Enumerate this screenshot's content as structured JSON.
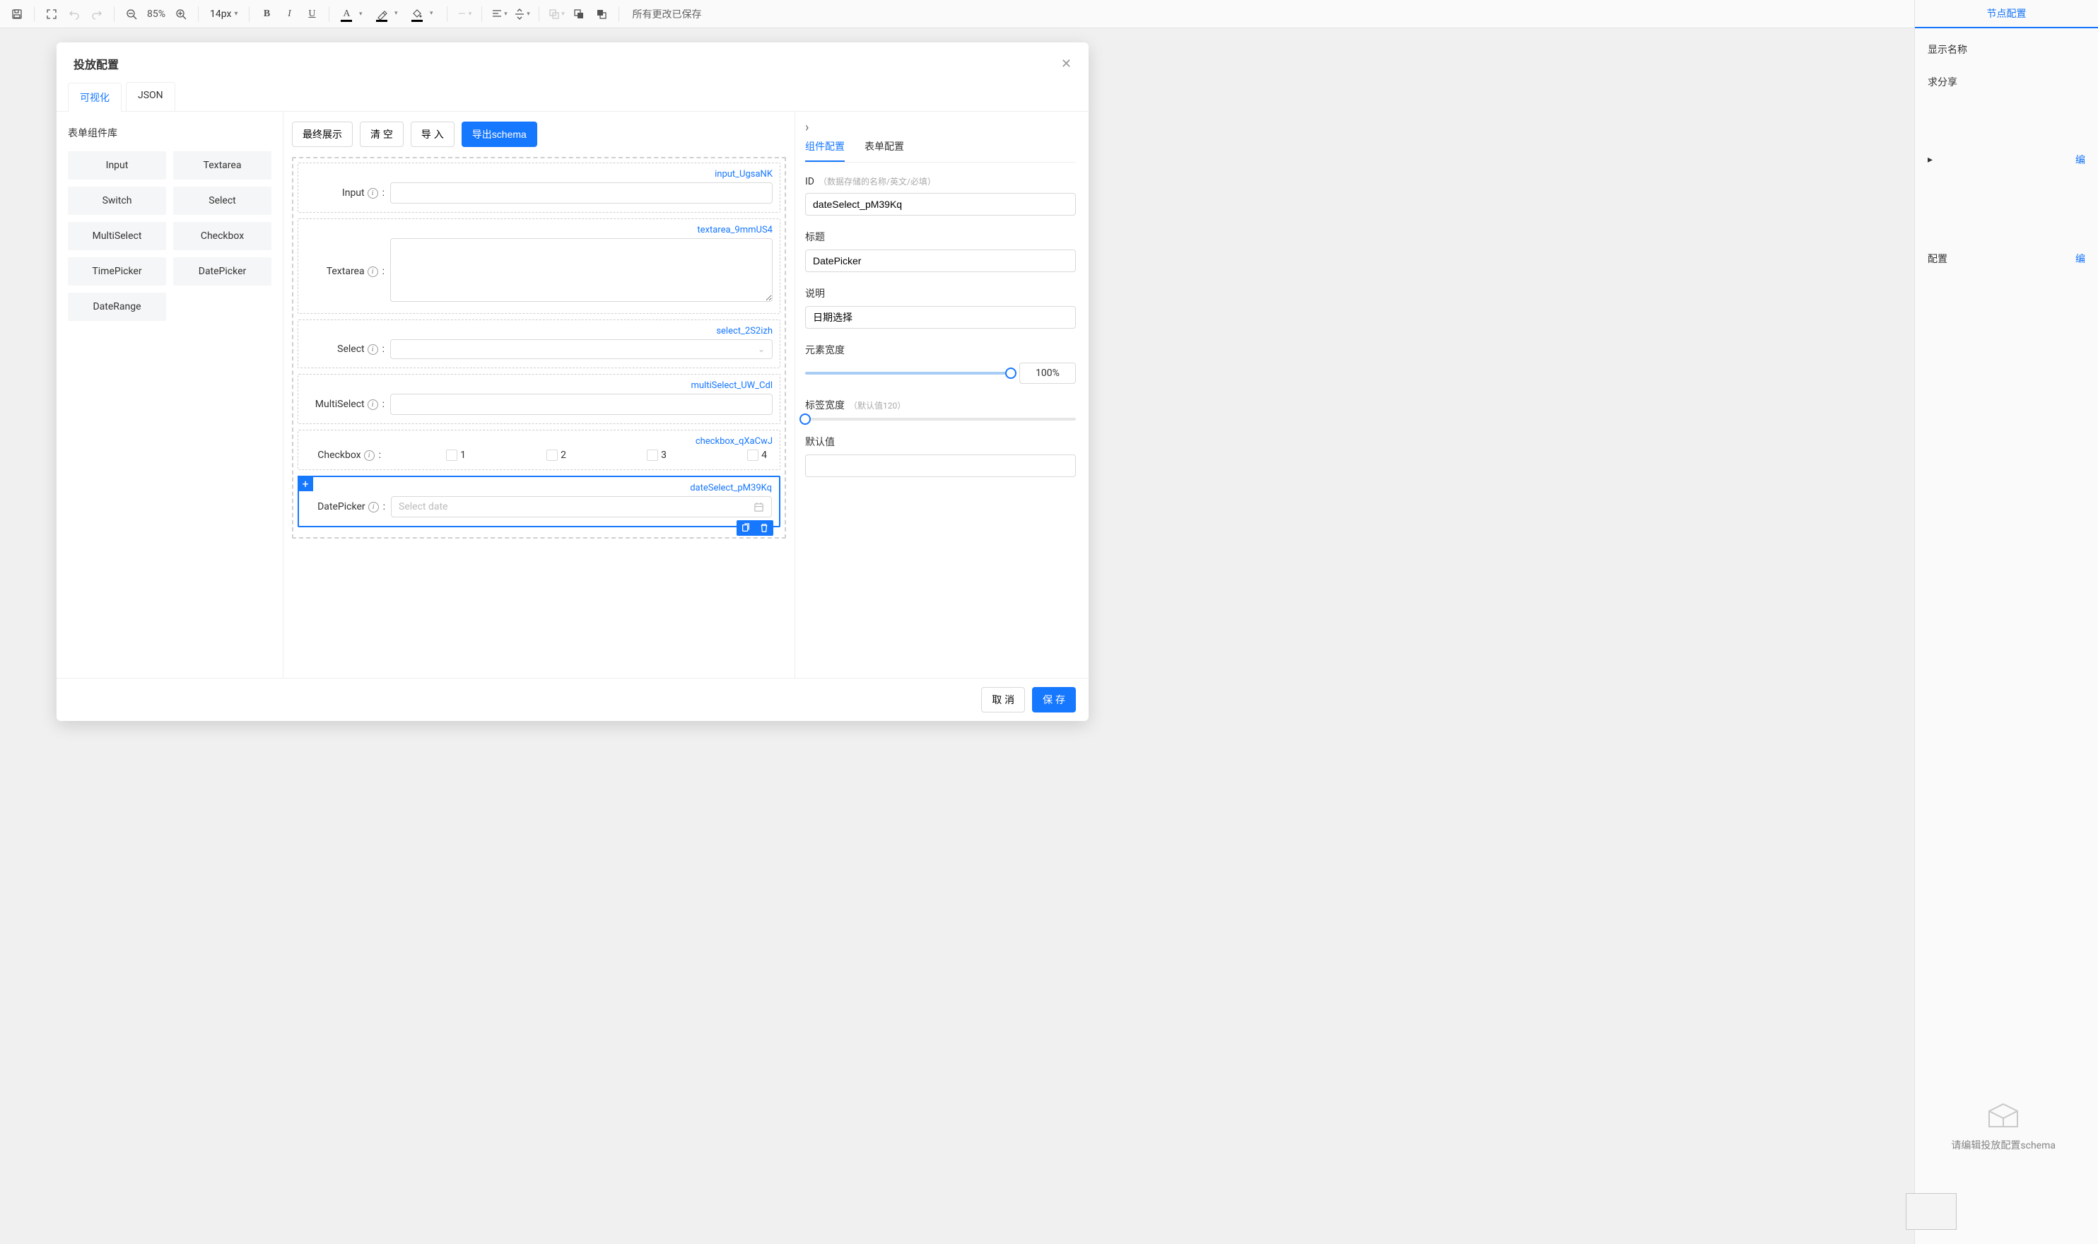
{
  "toolbar": {
    "zoom_text": "85%",
    "font_size": "14px",
    "status_text": "所有更改已保存"
  },
  "right_panel": {
    "active_tab": "节点配置",
    "display_name_label": "显示名称",
    "share_label": "求分享",
    "config_label": "配置",
    "edit_link1": "编",
    "edit_link2": "编",
    "placeholder_text": "请编辑投放配置schema"
  },
  "modal": {
    "title": "投放配置",
    "tabs": {
      "visual": "可视化",
      "json": "JSON"
    },
    "footer": {
      "cancel": "取 消",
      "save": "保 存"
    }
  },
  "form_library": {
    "title": "表单组件库",
    "items": [
      "Input",
      "Textarea",
      "Switch",
      "Select",
      "MultiSelect",
      "Checkbox",
      "TimePicker",
      "DatePicker",
      "DateRange"
    ]
  },
  "canvas": {
    "buttons": {
      "preview": "最终展示",
      "clear": "清 空",
      "import": "导 入",
      "export": "导出schema"
    },
    "items": [
      {
        "id": "input_UgsaNK",
        "label": "Input",
        "type": "input"
      },
      {
        "id": "textarea_9mmUS4",
        "label": "Textarea",
        "type": "textarea"
      },
      {
        "id": "select_2S2izh",
        "label": "Select",
        "type": "select"
      },
      {
        "id": "multiSelect_UW_Cdl",
        "label": "MultiSelect",
        "type": "input"
      },
      {
        "id": "checkbox_qXaCwJ",
        "label": "Checkbox",
        "type": "checkbox",
        "options": [
          "1",
          "2",
          "3",
          "4"
        ]
      },
      {
        "id": "dateSelect_pM39Kq",
        "label": "DatePicker",
        "type": "date",
        "placeholder": "Select date",
        "selected": true
      }
    ]
  },
  "config": {
    "tabs": {
      "component": "组件配置",
      "form": "表单配置"
    },
    "id": {
      "label": "ID",
      "hint": "（数据存储的名称/英文/必填）",
      "value": "dateSelect_pM39Kq"
    },
    "title": {
      "label": "标题",
      "value": "DatePicker"
    },
    "desc": {
      "label": "说明",
      "value": "日期选择"
    },
    "width": {
      "label": "元素宽度",
      "value": "100%",
      "percent": 100
    },
    "label_width": {
      "label": "标签宽度",
      "hint": "（默认值120）",
      "percent": 0
    },
    "default": {
      "label": "默认值",
      "value": ""
    }
  }
}
